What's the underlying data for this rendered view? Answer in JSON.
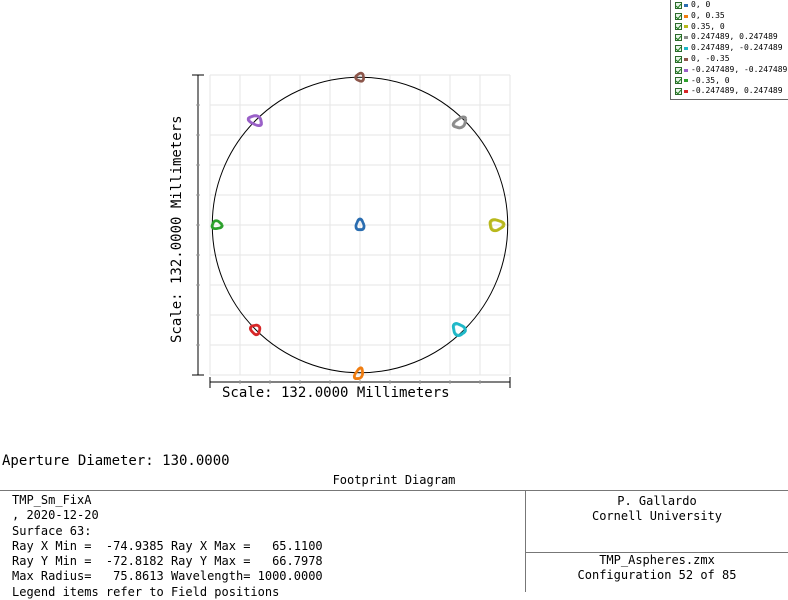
{
  "chart_data": {
    "type": "scatter",
    "xlabel": "Scale: 132.0000 Millimeters",
    "ylabel": "Scale: 132.0000 Millimeters",
    "xlim": [
      -66,
      66
    ],
    "ylim": [
      -66,
      66
    ],
    "grid": true,
    "aperture_diameter": 130.0,
    "legend_placement": "top-right",
    "series": [
      {
        "name": "0, 0",
        "color": "#2a6db0",
        "center": [
          0.0,
          0.0
        ]
      },
      {
        "name": "0, 0.35",
        "color": "#f07d10",
        "center": [
          -0.5,
          -65.5
        ]
      },
      {
        "name": "0.35, 0",
        "color": "#b8b81c",
        "center": [
          60.0,
          0.0
        ]
      },
      {
        "name": "0.247489, 0.247489",
        "color": "#8c8c8c",
        "center": [
          44.0,
          45.0
        ]
      },
      {
        "name": "0.247489, -0.247489",
        "color": "#1fb8c8",
        "center": [
          43.5,
          -46.0
        ]
      },
      {
        "name": "0, -0.35",
        "color": "#8c564b",
        "center": [
          0.0,
          65.0
        ]
      },
      {
        "name": "-0.247489, -0.247489",
        "color": "#9a60c8",
        "center": [
          -46.0,
          46.0
        ]
      },
      {
        "name": "-0.35, 0",
        "color": "#2ca02c",
        "center": [
          -63.0,
          0.0
        ]
      },
      {
        "name": "-0.247489, 0.247489",
        "color": "#d62728",
        "center": [
          -46.0,
          -46.0
        ]
      }
    ]
  },
  "legend_items": [
    "0, 0",
    "0, 0.35",
    "0.35, 0",
    "0.247489, 0.247489",
    "0.247489, -0.247489",
    "0, -0.35",
    "-0.247489, -0.247489",
    "-0.35, 0",
    "-0.247489, 0.247489"
  ],
  "aperture_text": "Aperture Diameter: 130.0000",
  "title": "Footprint Diagram",
  "info": {
    "line1": "TMP_Sm_FixA",
    "line2": ", 2020-12-20",
    "line3": "Surface 63:",
    "line4": "Ray X Min =  -74.9385 Ray X Max =   65.1100",
    "line5": "Ray Y Min =  -72.8182 Ray Y Max =   66.7978",
    "line6": "Max Radius=   75.8613 Wavelength= 1000.0000",
    "line7": "Legend items refer to Field positions"
  },
  "author": "P. Gallardo",
  "org": "Cornell University",
  "file": "TMP_Aspheres.zmx",
  "config": "Configuration 52 of 85"
}
